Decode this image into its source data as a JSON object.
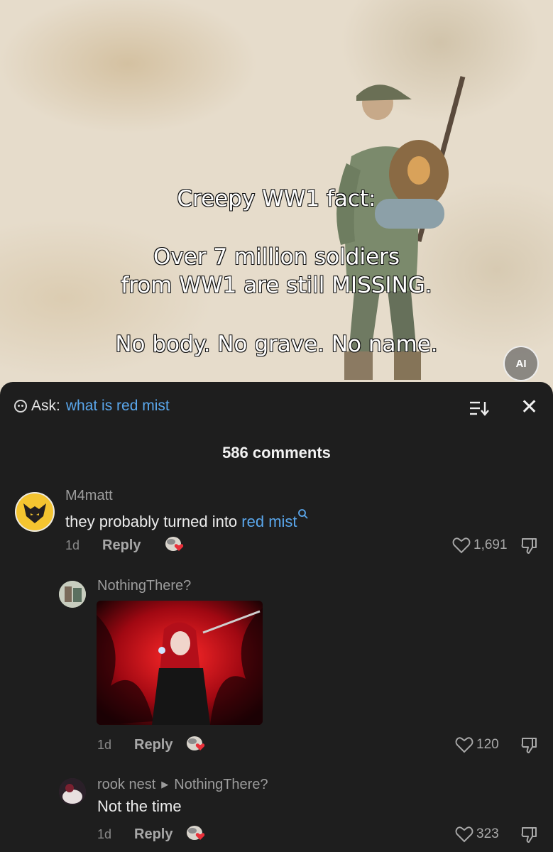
{
  "video": {
    "caption_line1": "Creepy WW1 fact:",
    "caption_line2": "Over 7 million soldiers",
    "caption_line3": "from WW1 are still MISSING.",
    "caption_line4": "No body. No grave. No name.",
    "ai_badge": "AI"
  },
  "ask": {
    "label": "Ask:",
    "query": "what is red mist",
    "icon": "ask-ai-icon"
  },
  "comments_count": "586 comments",
  "comments": [
    {
      "username": "M4matt",
      "text_prefix": "they probably turned into ",
      "text_link": "red mist",
      "time": "1d",
      "reply_label": "Reply",
      "likes": "1,691"
    },
    {
      "username": "NothingThere?",
      "time": "1d",
      "reply_label": "Reply",
      "likes": "120"
    },
    {
      "username": "rook nest",
      "reply_to": "NothingThere?",
      "text": "Not the time",
      "time": "1d",
      "reply_label": "Reply",
      "likes": "323"
    }
  ],
  "colors": {
    "panel_bg": "#1e1e1e",
    "link": "#5aa7ec",
    "like_heart_sticker": "#e8303a"
  }
}
